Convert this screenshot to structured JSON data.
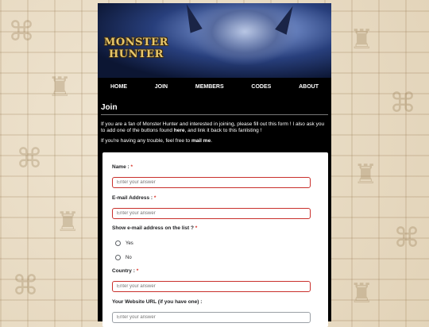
{
  "logo": {
    "line1": "MONSTER",
    "line2": "HUNTER"
  },
  "nav": [
    "HOME",
    "JOIN",
    "MEMBERS",
    "CODES",
    "ABOUT"
  ],
  "page": {
    "title": "Join",
    "intro_1": "If you are a fan of Monster Hunter and interested in joining, please fill out this form ! I also ask you to add one of the buttons found ",
    "intro_link": "here",
    "intro_2": ", and link it back to this fanlisting !",
    "trouble_1": "If you're having any trouble, feel free to ",
    "trouble_link": "mail me",
    "trouble_2": "."
  },
  "form": {
    "name_label": "Name : ",
    "email_label": "E-mail Address : ",
    "show_email_label": "Show e-mail address on the list ? ",
    "yes": "Yes",
    "no": "No",
    "country_label": "Country : ",
    "website_label": "Your Website URL (if you have one) :",
    "required_mark": "*",
    "placeholder": "Enter your answer"
  }
}
